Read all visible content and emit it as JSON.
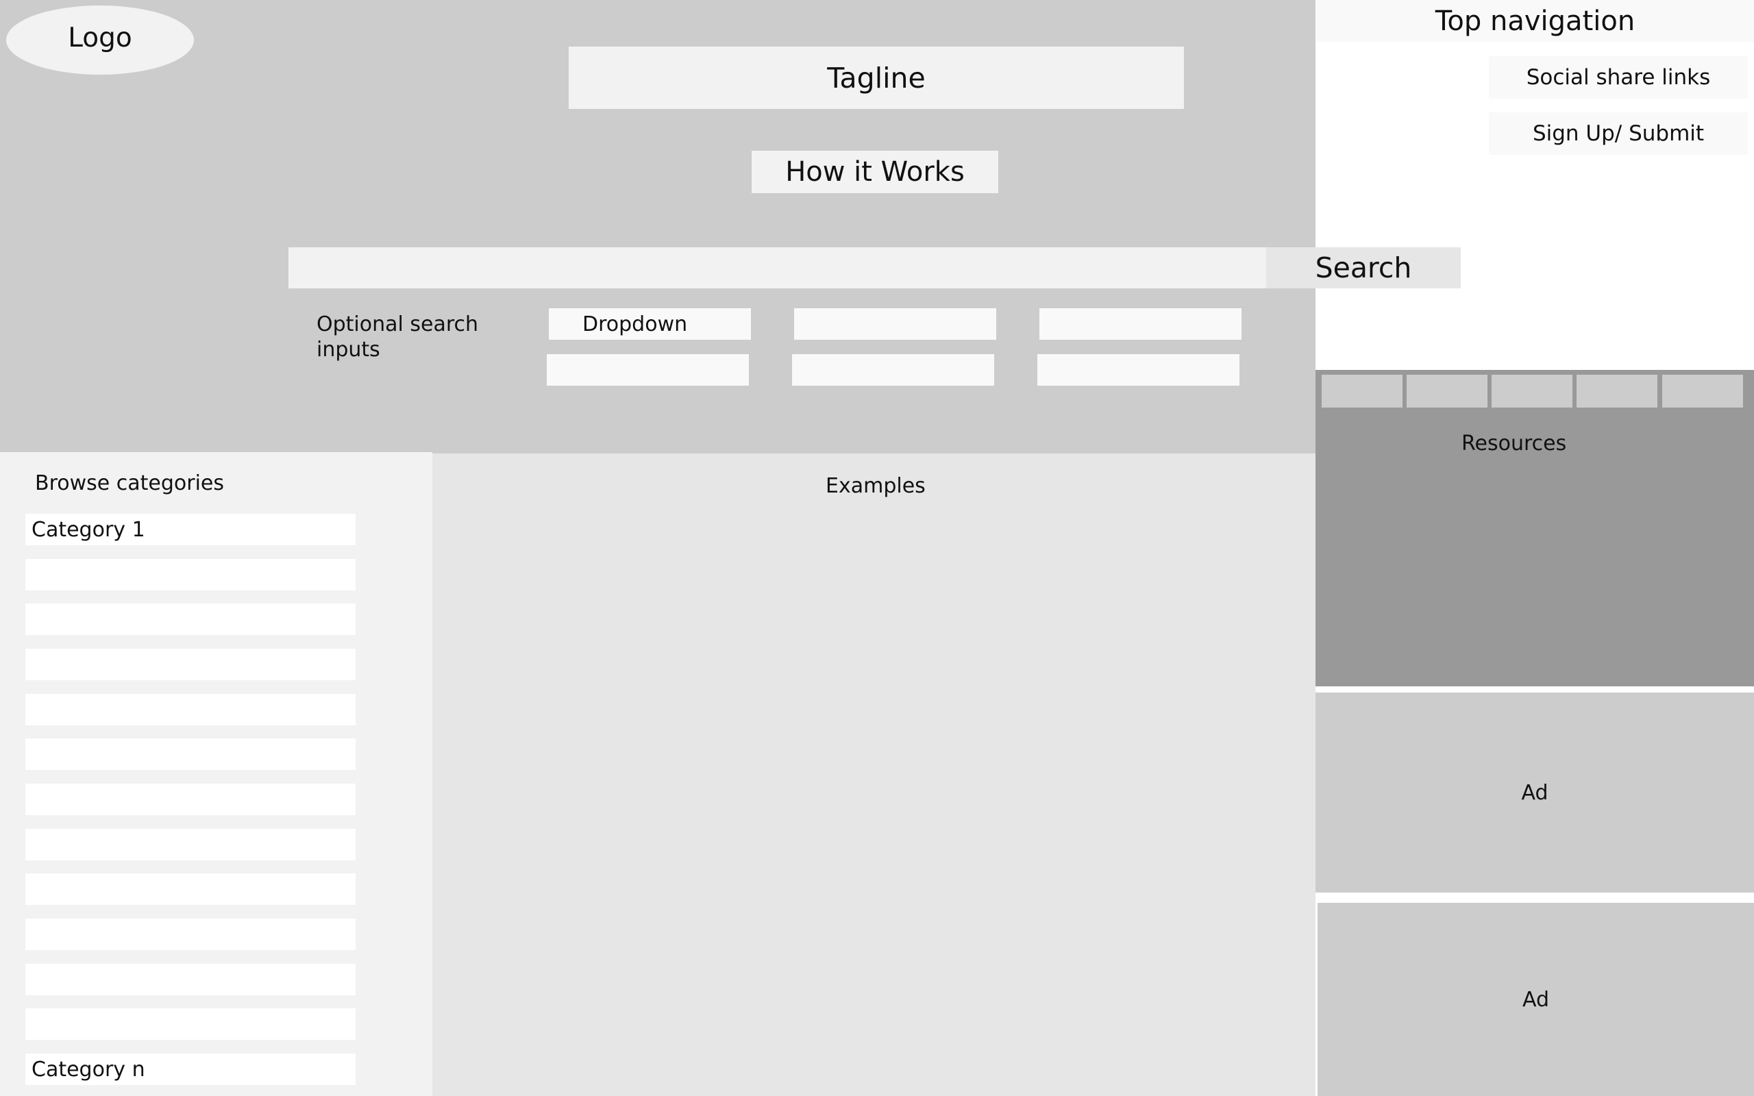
{
  "header": {
    "logo": "Logo",
    "tagline": "Tagline",
    "how_it_works": "How it Works",
    "top_navigation": "Top navigation",
    "social_share": "Social share links",
    "signup": "Sign Up/ Submit"
  },
  "search": {
    "button_label": "Search",
    "input_value": "",
    "optional_label": "Optional search inputs",
    "dropdown_label": "Dropdown"
  },
  "sidebar": {
    "title": "Browse categories",
    "categories": [
      "Category 1",
      "",
      "",
      "",
      "",
      "",
      "",
      "",
      "",
      "",
      "",
      "",
      "Category n"
    ]
  },
  "main": {
    "title": "Examples"
  },
  "right": {
    "resources_title": "Resources",
    "ad1": "Ad",
    "ad2": "Ad"
  }
}
